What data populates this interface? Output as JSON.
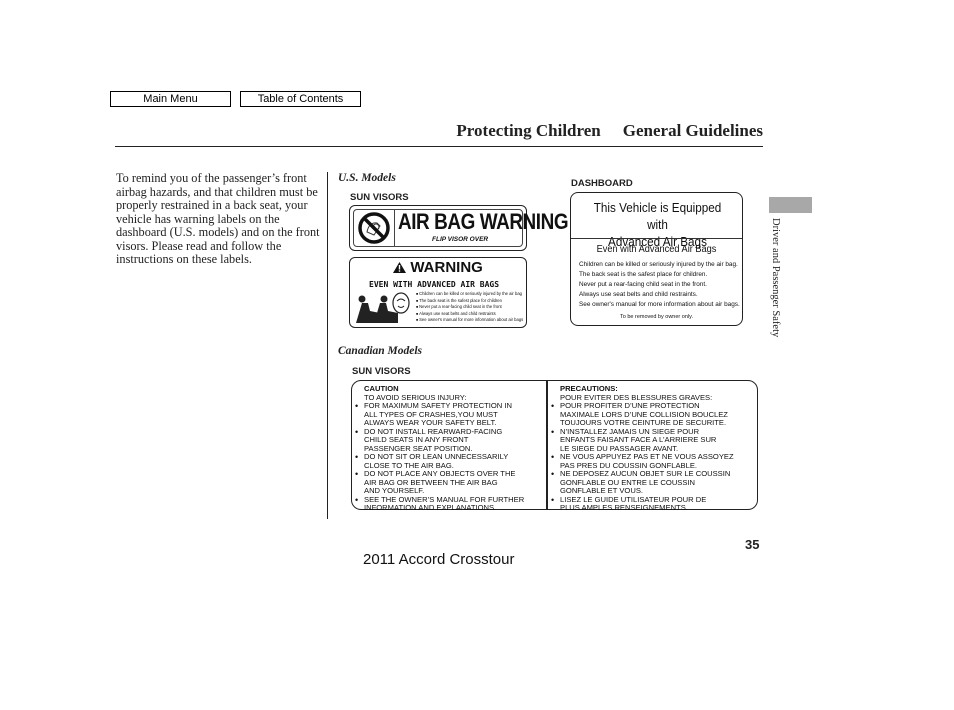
{
  "nav": {
    "main_menu": "Main Menu",
    "table_of_contents": "Table of Contents"
  },
  "header": {
    "section": "Protecting Children",
    "subsection": "General Guidelines"
  },
  "body_text": "To remind you of the passenger’s front airbag hazards, and that children must be properly restrained in a back seat, your vehicle has warning labels on the dashboard (U.S. models) and on the front visors. Please read and follow the instructions on these labels.",
  "us_models": {
    "heading": "U.S. Models",
    "sun_visors_label": "SUN VISORS",
    "dashboard_label": "DASHBOARD",
    "visor_label_1": {
      "icon": "no-child-seat-icon",
      "title": "AIR BAG WARNING",
      "subtitle": "FLIP VISOR OVER"
    },
    "visor_label_2": {
      "title": "WARNING",
      "icon": "warning-triangle-icon",
      "subtitle": "EVEN WITH ADVANCED AIR BAGS",
      "bullets": [
        "Children can be killed or seriously injured by the air bag",
        "The back seat is the safest place for children",
        "Never put a rear-facing child seat in the front",
        "Always use seat belts and child restraints",
        "See owner's manual for more information about air bags"
      ]
    },
    "dashboard_sign": {
      "title_line1": "This Vehicle is Equipped with",
      "title_line2": "Advanced Air Bags",
      "subtitle": "Even with Advanced Air Bags",
      "lines": [
        "Children can be killed or seriously injured by the air bag.",
        "The back seat is the safest place for children.",
        "Never put a rear-facing child seat in the front.",
        "Always use seat belts and child restraints.",
        "See owner's manual for more information about air bags."
      ],
      "footer": "To be removed by owner only."
    }
  },
  "canadian_models": {
    "heading": "Canadian Models",
    "sun_visors_label": "SUN VISORS",
    "english": {
      "title": "CAUTION",
      "subtitle": "TO AVOID SERIOUS INJURY:",
      "items": [
        [
          "FOR MAXIMUM SAFETY PROTECTION IN",
          "ALL TYPES OF CRASHES,YOU MUST",
          "ALWAYS WEAR YOUR SAFETY BELT."
        ],
        [
          "DO NOT INSTALL REARWARD-FACING",
          "CHILD SEATS IN ANY FRONT",
          "PASSENGER SEAT POSITION."
        ],
        [
          "DO NOT SIT OR LEAN UNNECESSARILY",
          "CLOSE TO THE AIR BAG."
        ],
        [
          "DO NOT PLACE ANY OBJECTS OVER THE",
          "AIR BAG OR BETWEEN THE AIR BAG",
          "AND YOURSELF."
        ],
        [
          "SEE THE OWNER’S MANUAL FOR FURTHER",
          "INFORMATION AND EXPLANATIONS."
        ]
      ]
    },
    "french": {
      "title": "PRECAUTIONS:",
      "subtitle": "POUR EVITER DES BLESSURES GRAVES:",
      "items": [
        [
          "POUR PROFITER D’UNE PROTECTION",
          "MAXIMALE LORS D’UNE COLLISION BOUCLEZ",
          "TOUJOURS VOTRE CEINTURE DE SECURITE."
        ],
        [
          "N’INSTALLEZ JAMAIS UN SIEGE POUR",
          "ENFANTS FAISANT FACE A L’ARRIERE SUR",
          "LE SIEGE DU PASSAGER AVANT."
        ],
        [
          "NE VOUS APPUYEZ PAS ET NE VOUS ASSOYEZ",
          "PAS PRES DU COUSSIN GONFLABLE."
        ],
        [
          "NE DEPOSEZ AUCUN OBJET SUR LE COUSSIN",
          "GONFLABLE OU ENTRE LE COUSSIN",
          "GONFLABLE ET VOUS."
        ],
        [
          "LISEZ LE GUIDE UTILISATEUR POUR DE",
          "PLUS AMPLES RENSEIGNEMENTS."
        ]
      ]
    }
  },
  "side_tab": {
    "label": "Driver and Passenger Safety",
    "color": "#a8a8a8"
  },
  "page_number": "35",
  "footer_title": "2011 Accord Crosstour"
}
